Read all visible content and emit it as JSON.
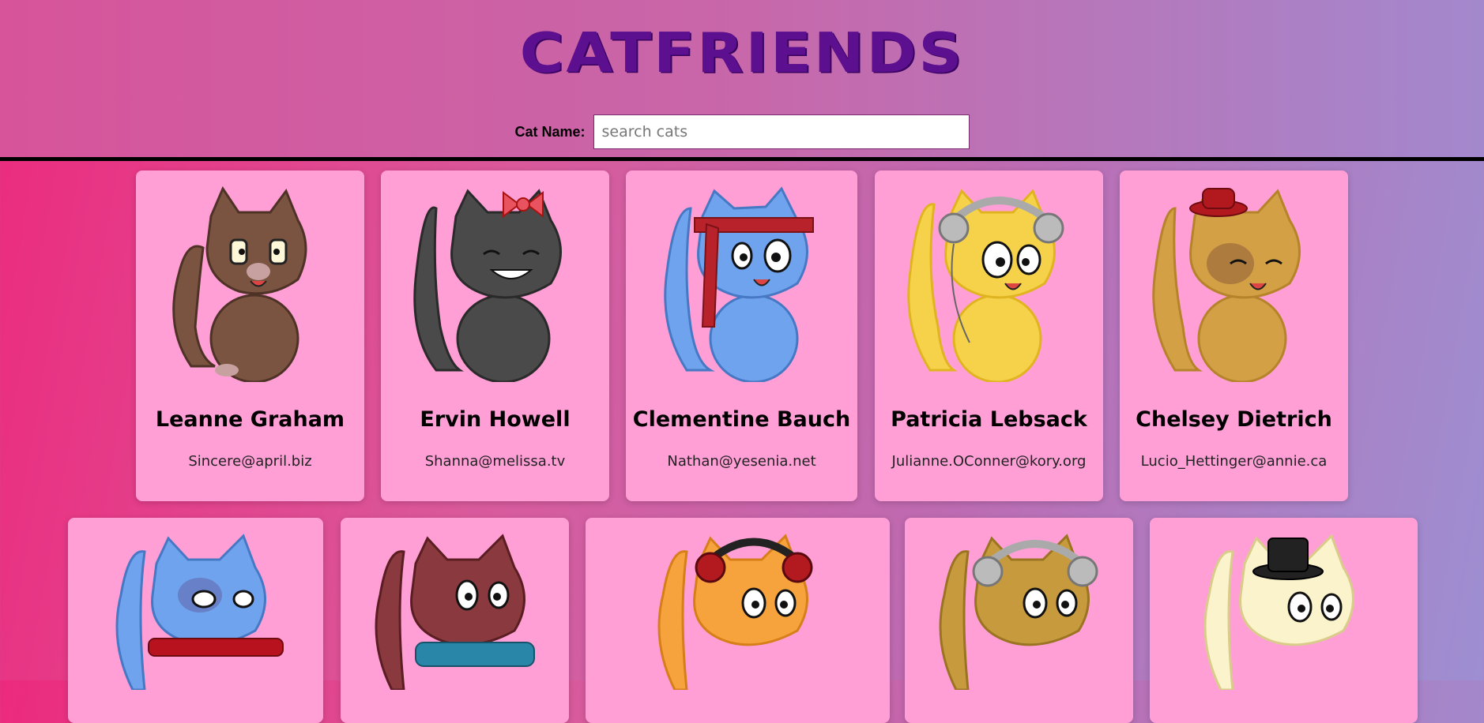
{
  "header": {
    "title": "CATFRIENDS",
    "search_label": "Cat Name:",
    "search_placeholder": "search cats",
    "search_value": ""
  },
  "colors": {
    "card_bg": "#ff9fd6",
    "title": "#5c0f8e"
  },
  "cats": [
    {
      "name": "Leanne Graham",
      "email": "Sincere@april.biz",
      "icon": "brown-cat-icon"
    },
    {
      "name": "Ervin Howell",
      "email": "Shanna@melissa.tv",
      "icon": "black-cat-bow-icon"
    },
    {
      "name": "Clementine Bauch",
      "email": "Nathan@yesenia.net",
      "icon": "blue-cat-headband-icon"
    },
    {
      "name": "Patricia Lebsack",
      "email": "Julianne.OConner@kory.org",
      "icon": "yellow-cat-headphones-icon"
    },
    {
      "name": "Chelsey Dietrich",
      "email": "Lucio_Hettinger@annie.ca",
      "icon": "tan-cat-hat-icon"
    },
    {
      "name": "",
      "email": "",
      "icon": "blue-cat-scarf-icon"
    },
    {
      "name": "",
      "email": "",
      "icon": "maroon-cat-scarf-icon"
    },
    {
      "name": "",
      "email": "",
      "icon": "orange-cat-headphones-icon"
    },
    {
      "name": "",
      "email": "",
      "icon": "tan-cat-headphones-icon"
    },
    {
      "name": "",
      "email": "",
      "icon": "cream-cat-tophat-icon"
    }
  ]
}
